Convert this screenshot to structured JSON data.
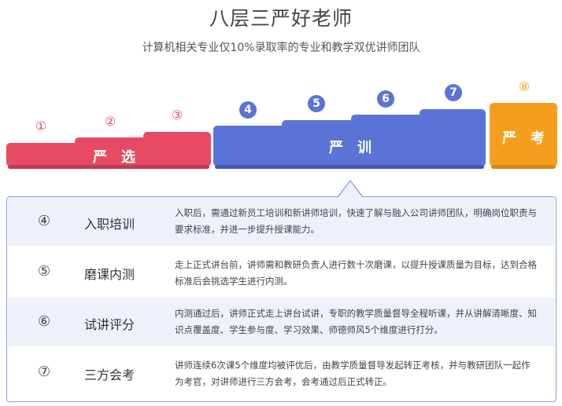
{
  "header": {
    "title": "八层三严好老师",
    "subtitle": "计算机相关专业仅10%录取率的专业和教学双优讲师团队"
  },
  "steps": [
    {
      "num": "①"
    },
    {
      "num": "②"
    },
    {
      "num": "③"
    },
    {
      "num": "4"
    },
    {
      "num": "5"
    },
    {
      "num": "6"
    },
    {
      "num": "7"
    },
    {
      "num": "⑧"
    }
  ],
  "bands": [
    {
      "label": "严　选",
      "color": "#e84a64"
    },
    {
      "label": "严　训",
      "color": "#5b73d6"
    },
    {
      "label": "严　考",
      "color": "#f59e1d"
    }
  ],
  "details": [
    {
      "num": "④",
      "name": "入职培训",
      "desc": "入职后，需通过新员工培训和新讲师培训，快速了解与融入公司讲师团队，明确岗位职责与要求标准，并进一步提升授课能力。"
    },
    {
      "num": "⑤",
      "name": "磨课内测",
      "desc": "走上正式讲台前，讲师需和教研负责人进行数十次磨课，以提升授课质量为目标，达到合格标准后会挑选学生进行内测。"
    },
    {
      "num": "⑥",
      "name": "试讲评分",
      "desc": "内测通过后，讲师正式走上讲台试讲，专职的教学质量督导全程听课，并从讲解清晰度、知识点覆盖度、学生参与度、学习效果、师德师风5个维度进行打分。"
    },
    {
      "num": "⑦",
      "name": "三方会考",
      "desc": "讲师连续6次课5个维度均被评优后，由教学质量督导发起转正考核，并与教研团队一起作为考官，对讲师进行三方会考，会考通过后正式转正。"
    }
  ]
}
